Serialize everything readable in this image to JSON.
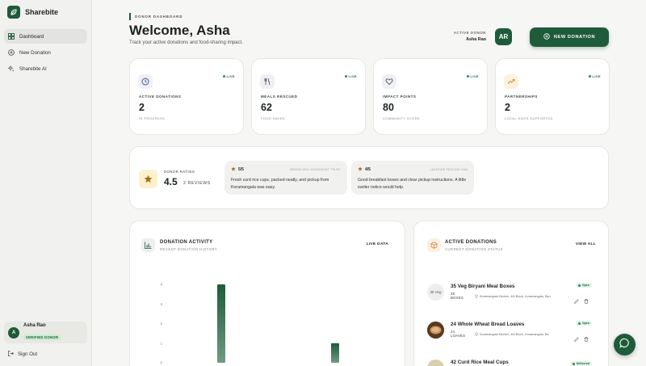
{
  "app": {
    "name": "Sharebite"
  },
  "sidebar": {
    "items": [
      {
        "label": "Dashboard",
        "icon": "grid-icon",
        "active": true
      },
      {
        "label": "New Donation",
        "icon": "plus-circle-icon",
        "active": false
      },
      {
        "label": "Sharebite AI",
        "icon": "sparkle-icon",
        "active": false
      }
    ],
    "user": {
      "initial": "A",
      "name": "Asha Rao",
      "badge": "VERIFIED DONOR"
    },
    "sign_out": "Sign Out"
  },
  "header": {
    "eyebrow": "DONOR DASHBOARD",
    "welcome": "Welcome, Asha",
    "subtitle": "Track your active donations and food-sharing impact.",
    "donor_label": "ACTIVE DONOR",
    "donor_name": "Asha Rao",
    "avatar_initials": "AR",
    "new_donation": "NEW DONATION"
  },
  "stats": [
    {
      "label": "ACTIVE DONATIONS",
      "value": "2",
      "sub": "IN PROGRESS",
      "live": "LIVE",
      "icon": "clock-icon"
    },
    {
      "label": "MEALS RESCUED",
      "value": "62",
      "sub": "FOOD SAVED",
      "live": "LIVE",
      "icon": "utensils-icon"
    },
    {
      "label": "IMPACT POINTS",
      "value": "80",
      "sub": "COMMUNITY SCORE",
      "live": "LIVE",
      "icon": "heart-icon"
    },
    {
      "label": "PARTNERSHIPS",
      "value": "2",
      "sub": "LOCAL NGOS SUPPORTED",
      "live": "LIVE",
      "icon": "trend-icon"
    }
  ],
  "rating": {
    "label": "DONOR RATING",
    "value": "4.5",
    "count": "2 REVIEWS",
    "reviews": [
      {
        "score": "5/5",
        "who": "BENGALURU GOODHEART TRUST",
        "text": "Fresh curd rice cups, packed neatly, and pickup from Koramangala was easy."
      },
      {
        "score": "4/5",
        "who": "LAKESIDE FEEDING HUB",
        "text": "Good breakfast boxes and clear pickup instructions. A little earlier notice would help."
      }
    ]
  },
  "activity": {
    "title": "DONATION ACTIVITY",
    "subtitle": "RECENT DONATION HISTORY",
    "link": "LIVE DATA"
  },
  "chart_data": {
    "type": "bar",
    "title": "DONATION ACTIVITY",
    "y_ticks": [
      "0",
      "1",
      "2",
      "3",
      "4"
    ],
    "ylim": [
      0,
      4
    ],
    "values": [
      4,
      1
    ],
    "color": "#1e5b3b"
  },
  "active_donations": {
    "title": "ACTIVE DONATIONS",
    "subtitle": "CURRENT DONATION STATUS",
    "link": "VIEW ALL",
    "items": [
      {
        "title": "35 Veg Biryani Meal Boxes",
        "qty": "35",
        "unit": "BOXES",
        "location": "Koramangala Kitchen, 4th Block, Koramangala, Ban",
        "status": "Open",
        "thumb_alt": "35 Veg"
      },
      {
        "title": "24 Whole Wheat Bread Loaves",
        "qty": "24",
        "unit": "LOAVES",
        "location": "Koramangala Kitchen, 4th Block, Koramangala, Ba",
        "status": "Open",
        "thumb_alt": ""
      },
      {
        "title": "42 Curd Rice Meal Cups",
        "qty": "",
        "unit": "",
        "location": "",
        "status": "Delivered",
        "thumb_alt": ""
      }
    ]
  }
}
